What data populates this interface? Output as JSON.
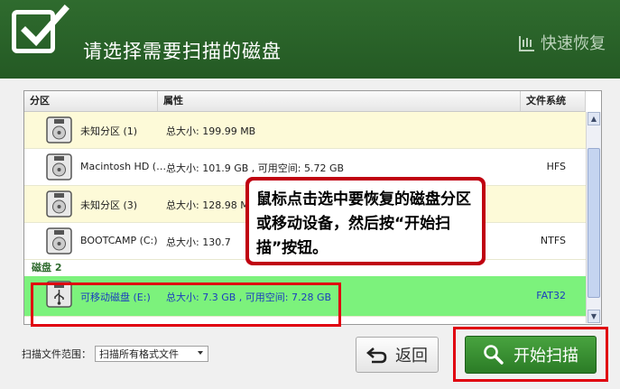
{
  "header": {
    "title": "请选择需要扫描的磁盘",
    "brand": "快速恢复"
  },
  "table": {
    "columns": [
      "分区",
      "属性",
      "文件系统"
    ],
    "disk1_rows": [
      {
        "name": "未知分区 (1)",
        "attr": "总大小: 199.99 MB",
        "fs": ""
      },
      {
        "name": "Macintosh HD (…",
        "attr": "总大小: 101.9 GB , 可用空间: 5.72 GB",
        "fs": "HFS"
      },
      {
        "name": "未知分区 (3)",
        "attr": "总大小: 128.98 M",
        "fs": ""
      },
      {
        "name": "BOOTCAMP (C:)",
        "attr": "总大小: 130.7",
        "fs": "NTFS"
      }
    ],
    "group2_label": "磁盘 2",
    "disk2_rows": [
      {
        "name": "可移动磁盘 (E:)",
        "attr": "总大小: 7.3 GB , 可用空间: 7.28 GB",
        "fs": "FAT32"
      }
    ]
  },
  "callout": {
    "text": "鼠标点击选中要恢复的磁盘分区或移动设备，然后按“开始扫描”按钮。"
  },
  "footer": {
    "scope_label": "扫描文件范围：",
    "scope_value": "扫描所有格式文件",
    "back_label": "返回",
    "start_label": "开始扫描"
  },
  "colors": {
    "header_green": "#2f6b2e",
    "selected_row": "#7cf27c",
    "highlight_red": "#e00010",
    "start_green": "#3a9133"
  }
}
